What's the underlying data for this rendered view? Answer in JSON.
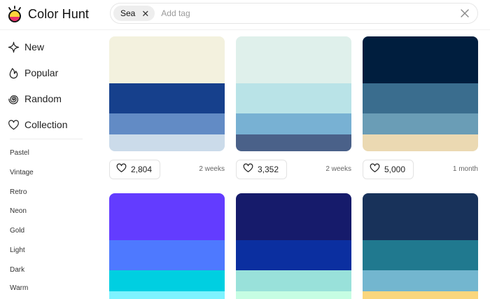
{
  "app": {
    "name": "Color Hunt"
  },
  "search": {
    "chip_label": "Sea",
    "placeholder": "Add tag"
  },
  "sidebar": {
    "nav": [
      {
        "label": "New",
        "icon": "sparkle-icon"
      },
      {
        "label": "Popular",
        "icon": "flame-icon"
      },
      {
        "label": "Random",
        "icon": "spiral-icon"
      },
      {
        "label": "Collection",
        "icon": "heart-icon"
      }
    ],
    "tags": [
      "Pastel",
      "Vintage",
      "Retro",
      "Neon",
      "Gold",
      "Light",
      "Dark",
      "Warm"
    ]
  },
  "palettes": [
    {
      "colors": [
        "#f3f1de",
        "#16408c",
        "#628bc5",
        "#cbdbea"
      ],
      "likes": "2,804",
      "date": "2 weeks"
    },
    {
      "colors": [
        "#dff0eb",
        "#b9e3e7",
        "#78b1d3",
        "#4a6189"
      ],
      "likes": "3,352",
      "date": "2 weeks"
    },
    {
      "colors": [
        "#001e3e",
        "#3a6d8e",
        "#6a9db6",
        "#ebd9b2"
      ],
      "likes": "5,000",
      "date": "1 month"
    },
    {
      "colors": [
        "#633cff",
        "#4e79ff",
        "#00cfe1",
        "#7ef3ff"
      ]
    },
    {
      "colors": [
        "#161b6b",
        "#0b2fa0",
        "#99e1da",
        "#c6fde3"
      ]
    },
    {
      "colors": [
        "#18325a",
        "#20798f",
        "#73b6cf",
        "#fad67d"
      ]
    }
  ]
}
